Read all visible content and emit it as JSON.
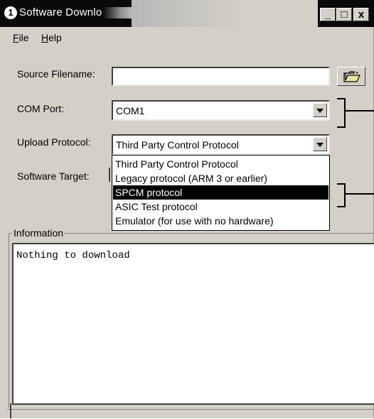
{
  "window": {
    "title": "Software Downlo",
    "icon_glyph": "1",
    "controls": {
      "minimize": "_",
      "maximize": "□",
      "close": "x"
    }
  },
  "menu": {
    "file": {
      "underline": "F",
      "rest": "ile"
    },
    "help": {
      "underline": "H",
      "rest": "elp"
    }
  },
  "form": {
    "source_label": "Source Filename:",
    "source_value": "",
    "com_label": "COM Port:",
    "com_value": "COM1",
    "upload_label": "Upload Protocol:",
    "upload_value": "Third Party Control Protocol",
    "target_label": "Software Target:"
  },
  "dropdown": {
    "options": [
      "Third Party Control Protocol",
      "Legacy protocol (ARM 3 or earlier)",
      "SPCM protocol",
      "ASIC Test protocol",
      "Emulator (for use with no hardware)"
    ],
    "selected_index": 2
  },
  "information": {
    "legend": "Information",
    "text": "Nothing to download"
  },
  "icons": {
    "app": "app-icon",
    "browse": "folder-open-icon",
    "dropdown_arrow": "chevron-down-icon"
  }
}
